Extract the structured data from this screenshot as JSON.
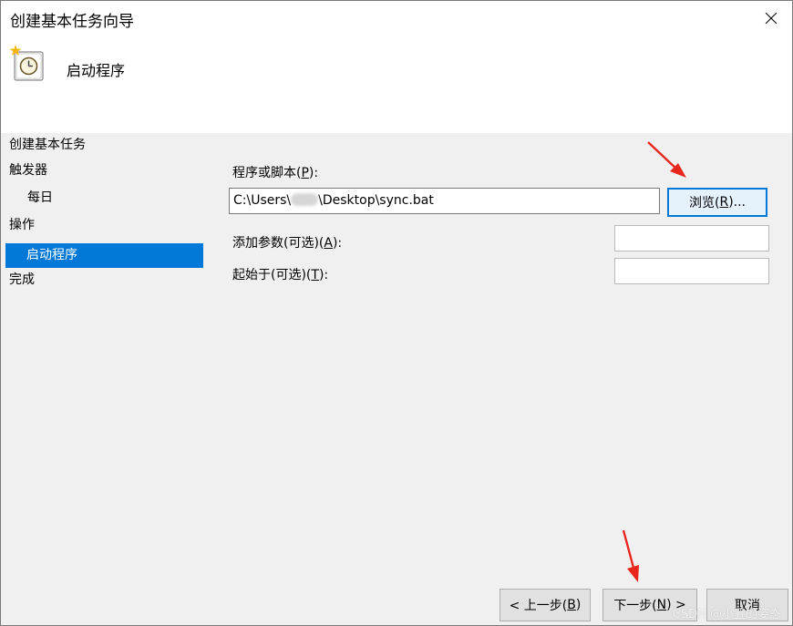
{
  "window": {
    "title": "创建基本任务向导"
  },
  "header": {
    "title": "启动程序"
  },
  "nav": {
    "items": [
      {
        "label": "创建基本任务"
      },
      {
        "label": "触发器"
      },
      {
        "label": "每日"
      },
      {
        "label": "操作"
      },
      {
        "label": "启动程序"
      },
      {
        "label": "完成"
      }
    ],
    "selected_index": 4
  },
  "form": {
    "program_label_prefix": "程序或脚本(",
    "program_label_key": "P",
    "program_label_suffix": "):",
    "program_value_prefix": "C:\\Users\\",
    "program_value_suffix": "\\Desktop\\sync.bat",
    "browse_prefix": "浏览(",
    "browse_key": "R",
    "browse_suffix": ")...",
    "args_label_prefix": "添加参数(可选)(",
    "args_label_key": "A",
    "args_label_suffix": "):",
    "args_value": "",
    "start_label_prefix": "起始于(可选)(",
    "start_label_key": "T",
    "start_label_suffix": "):",
    "start_value": ""
  },
  "footer": {
    "back_prefix": "< 上一步(",
    "back_key": "B",
    "back_suffix": ")",
    "next_prefix": "下一步(",
    "next_key": "N",
    "next_suffix": ") >",
    "cancel_label": "取消"
  },
  "watermark": "CSDN @小丑的姿态",
  "colors": {
    "selection": "#0078d7",
    "annotation_arrow": "#e8261c"
  },
  "icons": {
    "close": "close-icon",
    "header": "clock-task-icon"
  }
}
